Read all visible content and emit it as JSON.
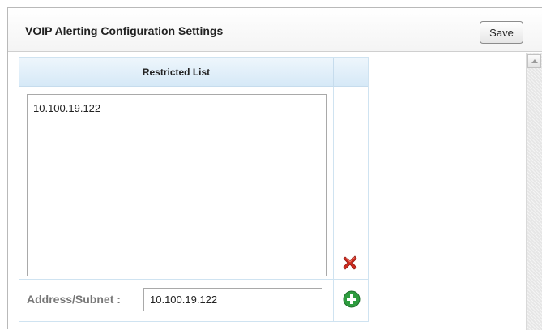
{
  "header": {
    "title": "VOIP Alerting Configuration Settings",
    "save_label": "Save"
  },
  "restricted_list": {
    "column_header": "Restricted List",
    "entries": [
      "10.100.19.122"
    ]
  },
  "address_form": {
    "label": "Address/Subnet :",
    "value": "10.100.19.122"
  },
  "icons": {
    "delete": "delete-x-icon",
    "add": "add-plus-icon",
    "scroll_up": "scroll-up-arrow-icon"
  },
  "colors": {
    "header_gradient_top": "#eef6fc",
    "header_gradient_bottom": "#d6e9f7",
    "delete_red": "#cc2a1e",
    "add_green": "#2e9c3f",
    "label_gray": "#777777"
  }
}
